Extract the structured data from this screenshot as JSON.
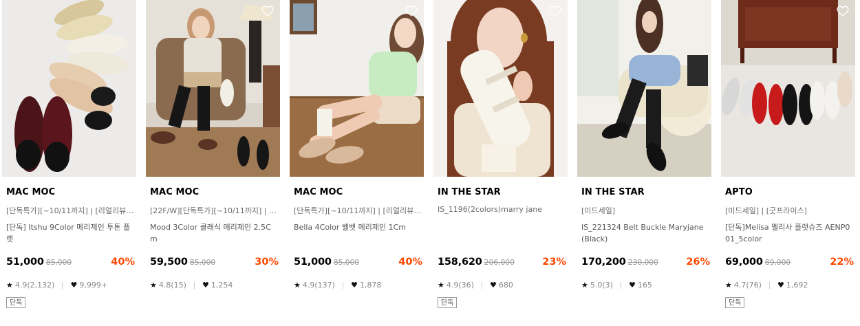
{
  "products": [
    {
      "brand": "MAC MOC",
      "tags": "[단독특가][~10/11까지] | [리얼리뷰][~",
      "name": "[단독] Itshu 9Color 메리제인 투톤 플랫",
      "price": "51,000",
      "original_price": "85,000",
      "discount": "40%",
      "rating": "4.9(2,132)",
      "likes": "9,999+",
      "badge": "단독",
      "image": "mary-jane-flats-assorted-colors"
    },
    {
      "brand": "MAC MOC",
      "tags": "[22F/W][단독특가][~10/11까지] | [포",
      "name": "Mood 3Color 클래식 메리제인 2.5Cm",
      "price": "59,500",
      "original_price": "85,000",
      "discount": "30%",
      "rating": "4.8(15)",
      "likes": "1,254",
      "badge": "",
      "image": "model-seated-armchair"
    },
    {
      "brand": "MAC MOC",
      "tags": "[단독특가][~10/11까지] | [리얼리뷰][~",
      "name": "Bella 4Color 벨벳 메리제인 1Cm",
      "price": "51,000",
      "original_price": "85,000",
      "discount": "40%",
      "rating": "4.9(137)",
      "likes": "1,878",
      "badge": "",
      "image": "model-seated-floor"
    },
    {
      "brand": "IN THE STAR",
      "tags": "IS_1196(2colors)marry jane",
      "name": "",
      "price": "158,620",
      "original_price": "206,000",
      "discount": "23%",
      "rating": "4.9(36)",
      "likes": "680",
      "badge": "단독",
      "image": "model-holding-white-shoe"
    },
    {
      "brand": "IN THE STAR",
      "tags": "[미드세일]",
      "name": "IS_221324 Belt Buckle Maryjane(Black)",
      "price": "170,200",
      "original_price": "230,000",
      "discount": "26%",
      "rating": "5.0(3)",
      "likes": "165",
      "badge": "",
      "image": "model-in-chair-black-shoes"
    },
    {
      "brand": "APTO",
      "tags": "[미드세일] | [굿프라이스]",
      "name": "[단독]Melisa 멜리사 플랫슈즈 AENP001_5color",
      "price": "69,000",
      "original_price": "89,000",
      "discount": "22%",
      "rating": "4.7(76)",
      "likes": "1,692",
      "badge": "단독",
      "image": "flat-shoes-row-on-floor"
    }
  ],
  "icons": {
    "wishlist": "heart-outline-icon",
    "rating": "star-icon",
    "likes": "heart-filled-icon"
  },
  "colors": {
    "discount": "#ff4800",
    "text": "#000000",
    "muted": "#888888"
  }
}
